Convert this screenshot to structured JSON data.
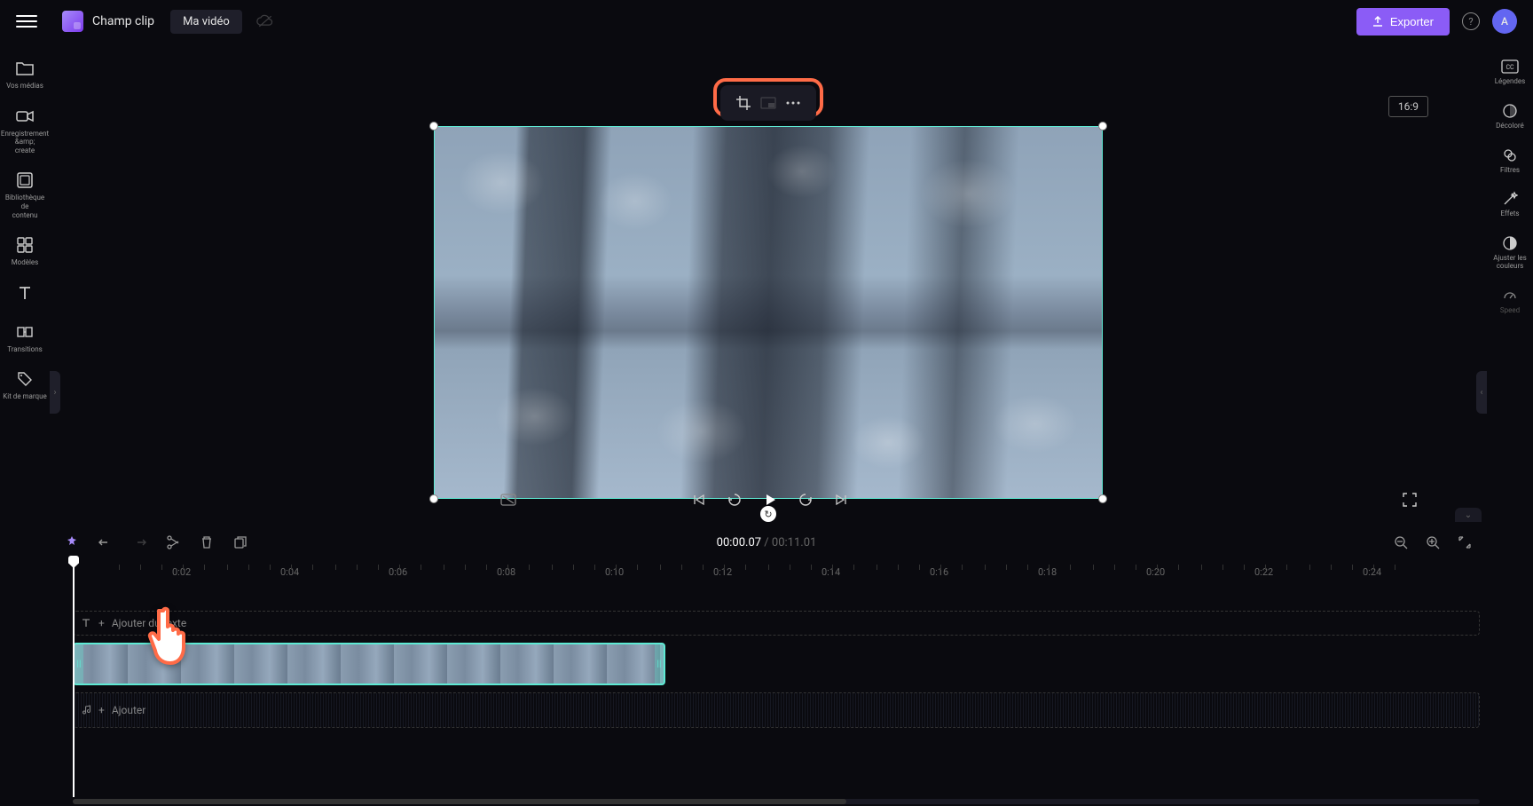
{
  "header": {
    "app_title": "Champ clip",
    "project_name": "Ma vidéo",
    "export_label": "Exporter",
    "avatar_letter": "A"
  },
  "aspect_ratio": "16:9",
  "left_sidebar": {
    "items": [
      {
        "label": "Vos médias"
      },
      {
        "label": "Enregistrement &amp;\ncreate"
      },
      {
        "label": "Bibliothèque de\ncontenu"
      },
      {
        "label": "Modèles"
      },
      {
        "label": ""
      },
      {
        "label": "Transitions"
      },
      {
        "label": "Kit de marque"
      }
    ]
  },
  "right_sidebar": {
    "items": [
      {
        "label": "Légendes"
      },
      {
        "label": "Décoloré"
      },
      {
        "label": "Filtres"
      },
      {
        "label": "Effets"
      },
      {
        "label": "Ajuster les\ncouleurs"
      },
      {
        "label": "Speed"
      }
    ]
  },
  "timeline": {
    "current_time": "00:00.07",
    "total_time": "00:11.01",
    "ticks": [
      "0:02",
      "0:04",
      "0:06",
      "0:08",
      "0:10",
      "0:12",
      "0:14",
      "0:16",
      "0:18",
      "0:20",
      "0:22",
      "0:24"
    ],
    "text_track_label": "Ajouter du texte",
    "audio_track_label": "Ajouter"
  }
}
